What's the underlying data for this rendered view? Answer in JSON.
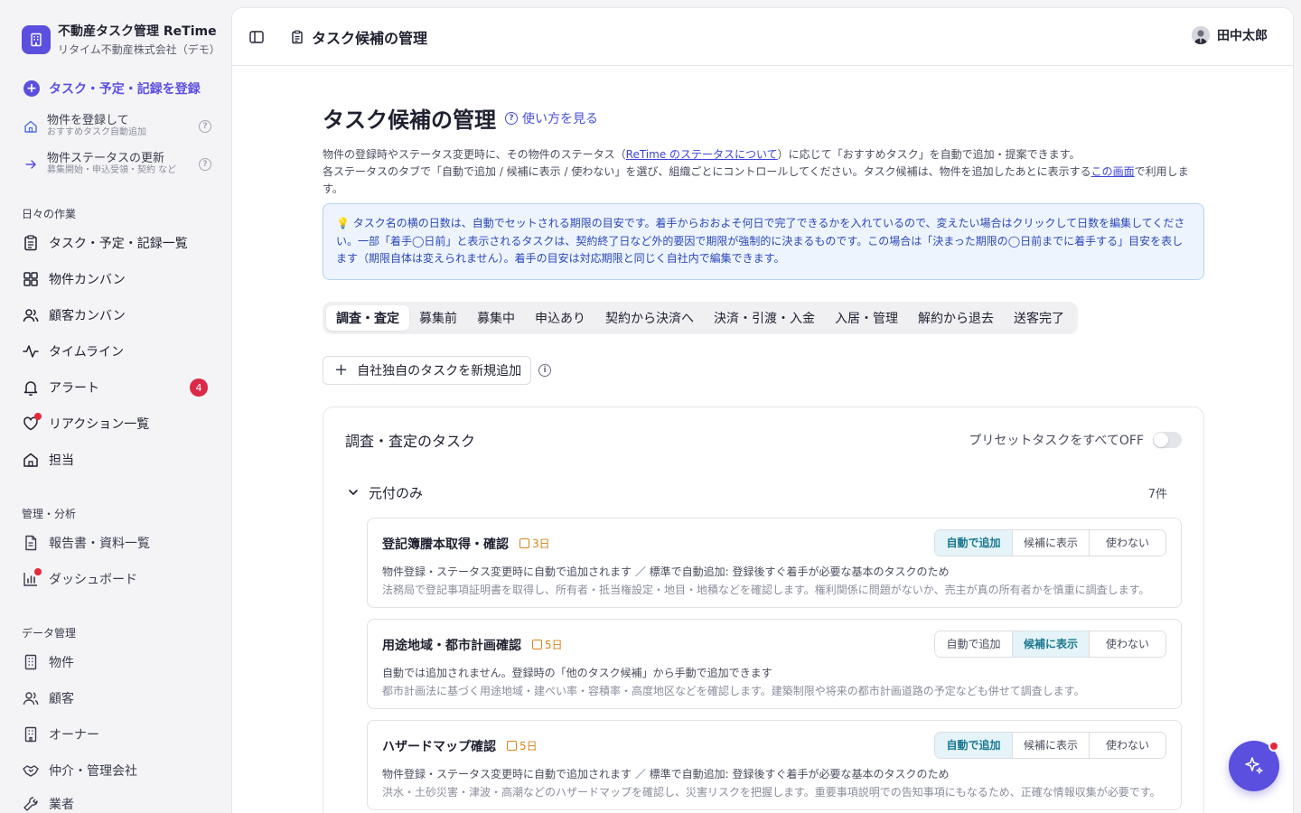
{
  "brand": {
    "name": "不動産タスク管理 ReTime",
    "company": "リタイム不動産株式会社（デモ）"
  },
  "sidebar": {
    "register": "タスク・予定・記録を登録",
    "sub_actions": [
      {
        "title": "物件を登録して",
        "sub": "おすすめタスク自動追加",
        "help": "?"
      },
      {
        "title": "物件ステータスの更新",
        "sub": "募集開始・申込受領・契約 など",
        "help": "?"
      }
    ],
    "sections": [
      {
        "label": "日々の作業"
      },
      {
        "label": "管理・分析"
      },
      {
        "label": "データ管理"
      }
    ],
    "daily": [
      {
        "label": "タスク・予定・記録一覧",
        "icon": "clipboard-icon"
      },
      {
        "label": "物件カンバン",
        "icon": "grid-icon"
      },
      {
        "label": "顧客カンバン",
        "icon": "users-icon"
      },
      {
        "label": "タイムライン",
        "icon": "activity-icon"
      },
      {
        "label": "アラート",
        "icon": "bell-icon",
        "badge": "4"
      },
      {
        "label": "リアクション一覧",
        "icon": "heart-icon"
      },
      {
        "label": "担当",
        "icon": "home-icon"
      }
    ],
    "manage": [
      {
        "label": "報告書・資料一覧",
        "icon": "document-icon"
      },
      {
        "label": "ダッシュボード",
        "icon": "chart-icon"
      }
    ],
    "data": [
      {
        "label": "物件",
        "icon": "building-icon"
      },
      {
        "label": "顧客",
        "icon": "user-icon"
      },
      {
        "label": "オーナー",
        "icon": "building-icon"
      },
      {
        "label": "仲介・管理会社",
        "icon": "handshake-icon"
      },
      {
        "label": "業者",
        "icon": "tool-icon"
      }
    ]
  },
  "header": {
    "page_title": "タスク候補の管理",
    "user_name": "田中太郎"
  },
  "main": {
    "title": "タスク候補の管理",
    "howto": "使い方を見る",
    "desc1_a": "物件の登録時やステータス変更時に、その物件のステータス（",
    "desc1_link": "ReTime のステータスについて",
    "desc1_b": "）に応じて「おすすめタスク」を自動で追加・提案できます。",
    "desc2_a": "各ステータスのタブで「自動で追加 / 候補に表示 / 使わない」を選び、組織ごとにコントロールしてください。タスク候補は、物件を追加したあとに表示する",
    "desc2_link": "この画面",
    "desc2_b": "で利用します。",
    "info": "💡 タスク名の横の日数は、自動でセットされる期限の目安です。着手からおおよそ何日で完了できるかを入れているので、変えたい場合はクリックして日数を編集してください。一部「着手◯日前」と表示されるタスクは、契約終了日など外的要因で期限が強制的に決まるものです。この場合は「決まった期限の◯日前までに着手する」目安を表します（期限自体は変えられません）。着手の目安は対応期限と同じく自社内で編集できます。",
    "tabs": [
      "調査・査定",
      "募集前",
      "募集中",
      "申込あり",
      "契約から決済へ",
      "決済・引渡・入金",
      "入居・管理",
      "解約から退去",
      "送客完了"
    ],
    "active_tab": 0,
    "add_button": "自社独自のタスクを新規追加",
    "card_title": "調査・査定のタスク",
    "preset_label": "プリセットタスクをすべてOFF",
    "group_title": "元付のみ",
    "group_count": "7件",
    "seg_options": [
      "自動で追加",
      "候補に表示",
      "使わない"
    ],
    "tasks": [
      {
        "name": "登記簿謄本取得・確認",
        "days": "3日",
        "selected": 0,
        "line1": "物件登録・ステータス変更時に自動で追加されます ／ 標準で自動追加: 登録後すぐ着手が必要な基本のタスクのため",
        "line2": "法務局で登記事項証明書を取得し、所有者・抵当権設定・地目・地積などを確認します。権利関係に問題がないか、売主が真の所有者かを慎重に調査します。"
      },
      {
        "name": "用途地域・都市計画確認",
        "days": "5日",
        "selected": 1,
        "line1": "自動では追加されません。登録時の「他のタスク候補」から手動で追加できます",
        "line2": "都市計画法に基づく用途地域・建ぺい率・容積率・高度地区などを確認します。建築制限や将来の都市計画道路の予定なども併せて調査します。"
      },
      {
        "name": "ハザードマップ確認",
        "days": "5日",
        "selected": 0,
        "line1": "物件登録・ステータス変更時に自動で追加されます ／ 標準で自動追加: 登録後すぐ着手が必要な基本のタスクのため",
        "line2": "洪水・土砂災害・津波・高潮などのハザードマップを確認し、災害リスクを把握します。重要事項説明での告知事項にもなるため、正確な情報収集が必要です。"
      }
    ]
  }
}
